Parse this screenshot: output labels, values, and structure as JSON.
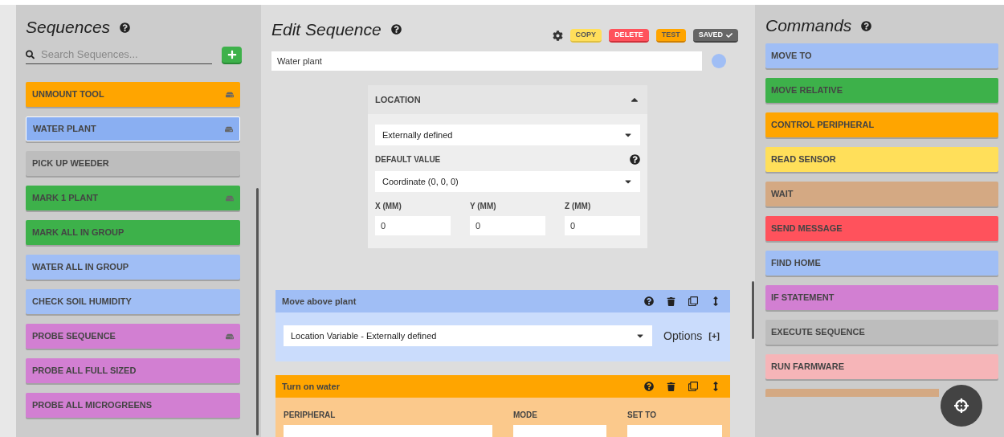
{
  "sequences": {
    "title": "Sequences",
    "search": {
      "placeholder": "Search Sequences..."
    },
    "items": [
      {
        "label": "UNMOUNT TOOL",
        "color": "#ffa500",
        "selected": false,
        "pinned": true
      },
      {
        "label": "WATER PLANT",
        "color": "#8aaff2",
        "selected": true,
        "pinned": true
      },
      {
        "label": "PICK UP WEEDER",
        "color": "#bdbdbd",
        "selected": false,
        "pinned": false
      },
      {
        "label": "MARK 1 PLANT",
        "color": "#3db14a",
        "selected": false,
        "pinned": true
      },
      {
        "label": "MARK ALL IN GROUP",
        "color": "#3db14a",
        "selected": false,
        "pinned": false
      },
      {
        "label": "WATER ALL IN GROUP",
        "color": "#a0bef5",
        "selected": false,
        "pinned": false
      },
      {
        "label": "CHECK SOIL HUMIDITY",
        "color": "#a0bef5",
        "selected": false,
        "pinned": false
      },
      {
        "label": "PROBE SEQUENCE",
        "color": "#d27fd2",
        "selected": false,
        "pinned": true
      },
      {
        "label": "PROBE ALL FULL SIZED",
        "color": "#d27fd2",
        "selected": false,
        "pinned": false
      },
      {
        "label": "PROBE ALL MICROGREENS",
        "color": "#d27fd2",
        "selected": false,
        "pinned": false
      }
    ]
  },
  "editor": {
    "title": "Edit Sequence",
    "actions": [
      {
        "label": "COPY",
        "kind": "copy"
      },
      {
        "label": "DELETE",
        "kind": "delete"
      },
      {
        "label": "TEST",
        "kind": "test"
      },
      {
        "label": "SAVED",
        "kind": "saved"
      }
    ],
    "name": "Water plant",
    "color": "#a0bef5",
    "location": {
      "title": "LOCATION",
      "expanded": true,
      "source": "Externally defined",
      "default_label": "DEFAULT VALUE",
      "default_value": "Coordinate (0, 0, 0)",
      "axes": [
        {
          "label": "X (MM)",
          "value": "0"
        },
        {
          "label": "Y (MM)",
          "value": "0"
        },
        {
          "label": "Z (MM)",
          "value": "0"
        }
      ]
    },
    "steps": [
      {
        "title": "Move above plant",
        "kind": "move",
        "value": "Location Variable - Externally defined",
        "options_label": "Options",
        "options_toggle": "[+]"
      },
      {
        "title": "Turn on water",
        "kind": "peripheral",
        "fields": [
          "PERIPHERAL",
          "MODE",
          "SET TO"
        ]
      }
    ]
  },
  "commands": {
    "title": "Commands",
    "items": [
      {
        "label": "MOVE TO",
        "color": "#a0bef5"
      },
      {
        "label": "MOVE RELATIVE",
        "color": "#3db14a"
      },
      {
        "label": "CONTROL PERIPHERAL",
        "color": "#ffa500"
      },
      {
        "label": "READ SENSOR",
        "color": "#ffdf5a"
      },
      {
        "label": "WAIT",
        "color": "#d4a983"
      },
      {
        "label": "SEND MESSAGE",
        "color": "#ff525c"
      },
      {
        "label": "FIND HOME",
        "color": "#a0bef5"
      },
      {
        "label": "IF STATEMENT",
        "color": "#d27fd2"
      },
      {
        "label": "EXECUTE SEQUENCE",
        "color": "#bdbdbd"
      },
      {
        "label": "RUN FARMWARE",
        "color": "#f6b5b8"
      }
    ]
  }
}
